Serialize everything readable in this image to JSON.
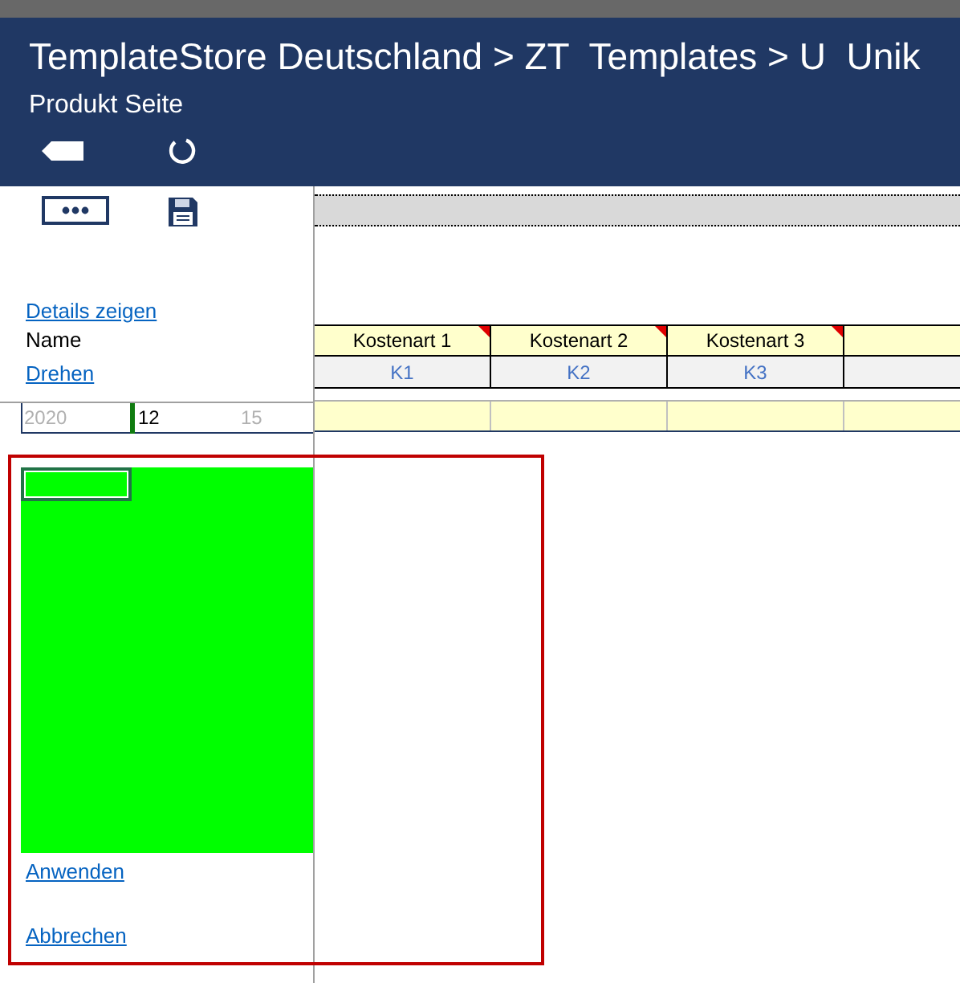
{
  "header": {
    "breadcrumb": "TemplateStore Deutschland > ZT  Templates > U  Unik",
    "subtitle": "Produkt Seite"
  },
  "links": {
    "details": "Details zeigen",
    "name_label": "Name",
    "rotate": "Drehen"
  },
  "columns": [
    {
      "label": "Kostenart 1",
      "code": "K1"
    },
    {
      "label": "Kostenart 2",
      "code": "K2"
    },
    {
      "label": "Kostenart 3",
      "code": "K3"
    }
  ],
  "period": {
    "start": "2020",
    "value": "12",
    "end": "15"
  },
  "actions": [
    "Anwenden",
    "Abbrechen"
  ]
}
